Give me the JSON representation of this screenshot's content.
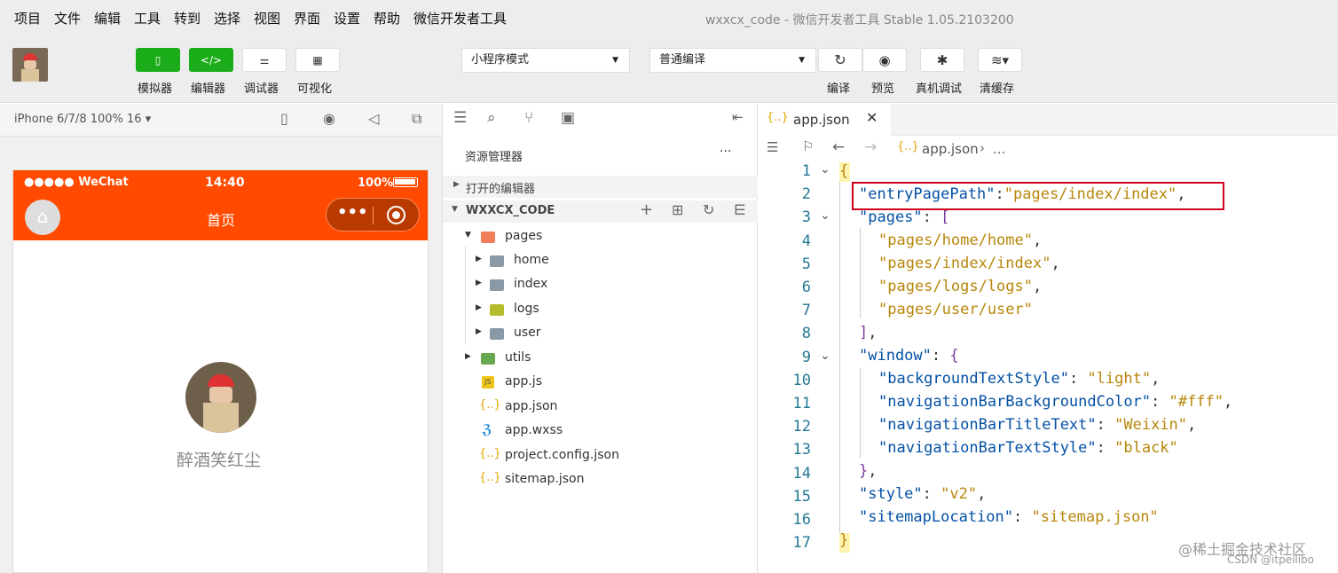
{
  "menubar": {
    "items": [
      "项目",
      "文件",
      "编辑",
      "工具",
      "转到",
      "选择",
      "视图",
      "界面",
      "设置",
      "帮助",
      "微信开发者工具"
    ],
    "window_title": "wxxcx_code - 微信开发者工具 Stable 1.05.2103200"
  },
  "toolbar": {
    "simulator": "模拟器",
    "editor": "编辑器",
    "debugger": "调试器",
    "visual": "可视化",
    "mode": "小程序模式",
    "compile_mode": "普通编译",
    "compile": "编译",
    "preview": "预览",
    "real_debug": "真机调试",
    "clear_cache": "清缓存"
  },
  "simulator": {
    "device": "iPhone 6/7/8 100% 16 ▾",
    "status_left": "●●●●● WeChat",
    "time": "14:40",
    "battery": "100%",
    "nav_title": "首页",
    "nickname": "醉酒笑红尘"
  },
  "explorer": {
    "title": "资源管理器",
    "more": "···",
    "open_editors": "打开的编辑器",
    "project": "WXXCX_CODE",
    "items": [
      "pages",
      "home",
      "index",
      "logs",
      "user",
      "utils",
      "app.js",
      "app.json",
      "app.wxss",
      "project.config.json",
      "sitemap.json"
    ]
  },
  "editor": {
    "tab": "app.json",
    "breadcrumb": "app.json",
    "breadcrumb_more": "...",
    "lines": [
      "1",
      "2",
      "3",
      "4",
      "5",
      "6",
      "7",
      "8",
      "9",
      "10",
      "11",
      "12",
      "13",
      "14",
      "15",
      "16",
      "17"
    ]
  },
  "watermark": "@稀土掘金技术社区",
  "watermark2": "CSDN @itpeilibo",
  "colors": {
    "wechat_green": "#1aad19",
    "nav_red": "#ff4a00",
    "highlight_box": "#d0021b"
  }
}
